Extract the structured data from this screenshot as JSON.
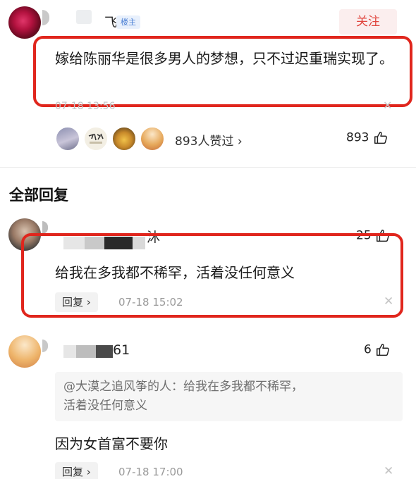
{
  "top_comment": {
    "author_suffix": "飞",
    "host_badge": "楼主",
    "follow_label": "关注",
    "text": "嫁给陈丽华是很多男人的梦想，只不过迟重瑞实现了。",
    "time_faint": "07-18 13:56",
    "likes_text": "893人赞过 ›",
    "like_count": "893"
  },
  "section": {
    "title": "全部回复"
  },
  "replies": [
    {
      "author_suffix": "沐",
      "like_count": "25",
      "text": "给我在多我都不稀罕，活着没任何意义",
      "reply_label": "回复 ›",
      "time": "07-18 15:02"
    },
    {
      "author_suffix": "61",
      "like_count": "6",
      "quote_line1": "@大漠之追风筝的人：给我在多我都不稀罕，",
      "quote_line2": "活着没任何意义",
      "text": "因为女首富不要你",
      "reply_label": "回复 ›",
      "time": "07-18 17:00"
    }
  ],
  "colors": {
    "highlight_box": "#e0261d",
    "follow": "#e0453d",
    "badge": "#4a7fd4"
  },
  "icons": [
    "thumbs-up-icon",
    "close-icon"
  ]
}
